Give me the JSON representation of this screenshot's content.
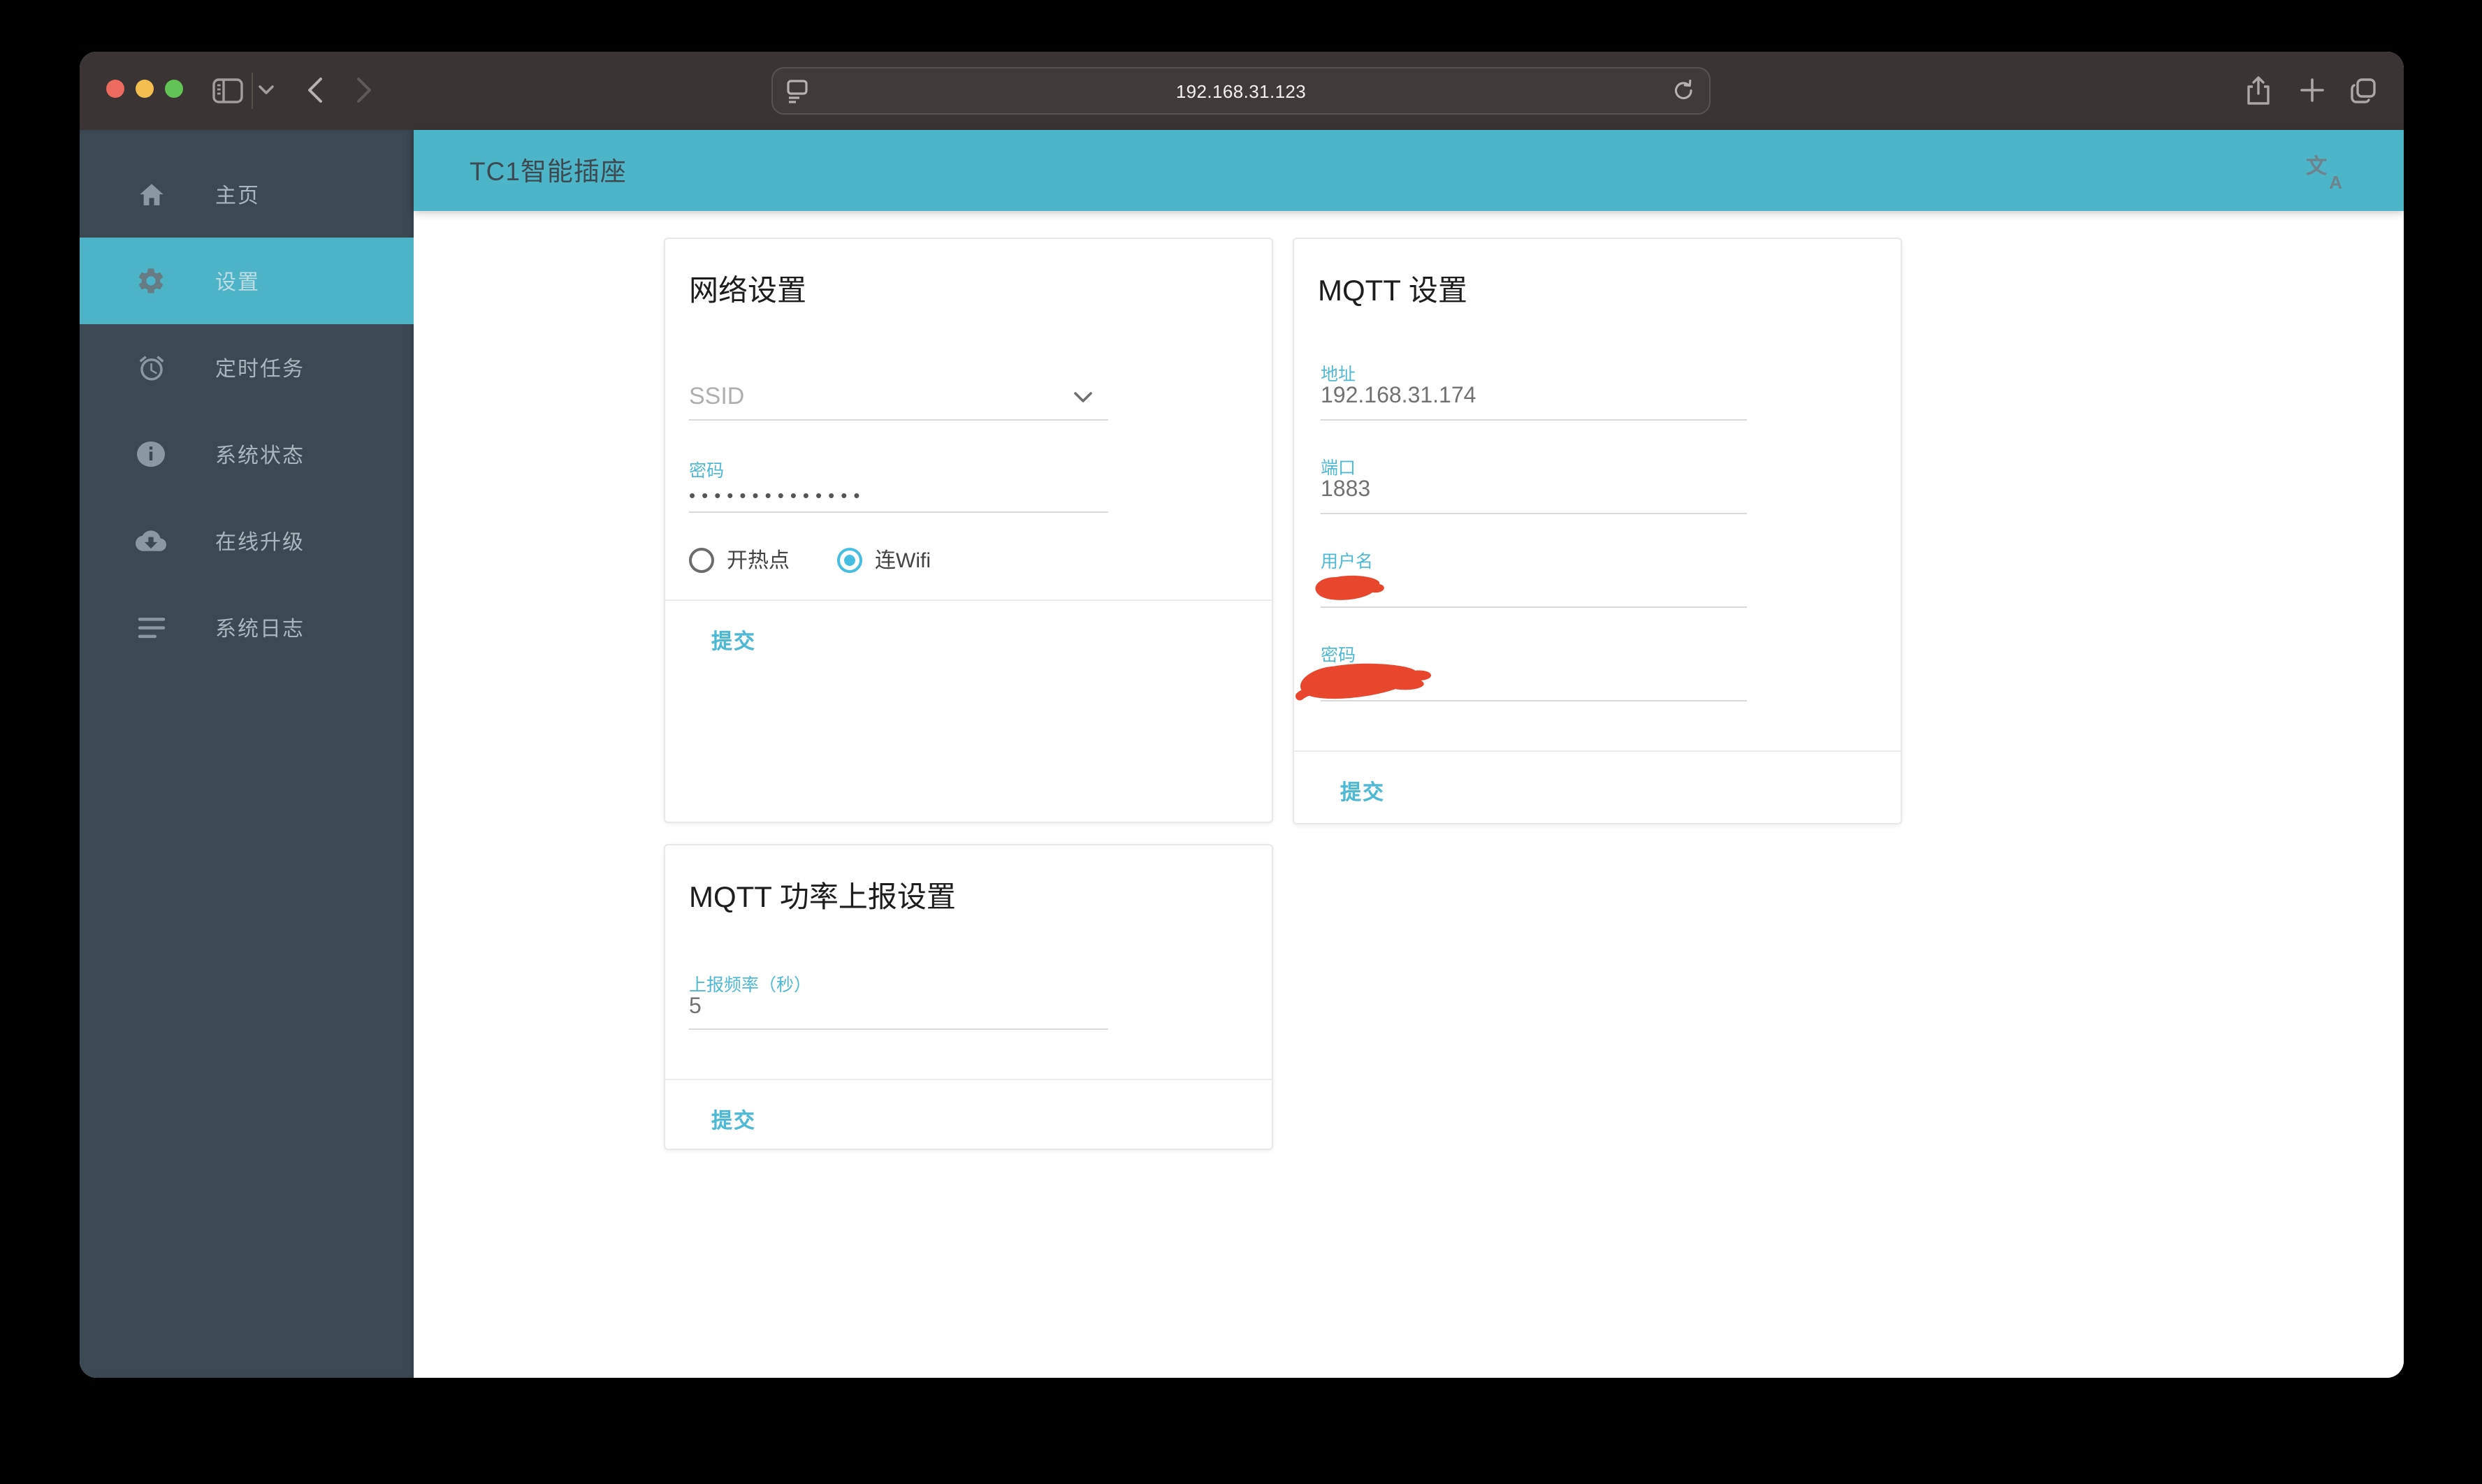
{
  "browser": {
    "url": "192.168.31.123",
    "traffic_lights": [
      "close",
      "minimize",
      "zoom"
    ],
    "left_icons": [
      "sidebar-toggle-icon",
      "chevron-down-icon",
      "back-icon",
      "forward-icon"
    ],
    "url_icons": [
      "reader-icon",
      "refresh-icon"
    ],
    "right_icons": [
      "share-icon",
      "new-tab-icon",
      "tab-overview-icon"
    ]
  },
  "header": {
    "title": "TC1智能插座",
    "translate_icon": {
      "zh": "文",
      "en": "A"
    }
  },
  "sidebar": {
    "items": [
      {
        "label": "主页",
        "icon": "home-icon",
        "active": false
      },
      {
        "label": "设置",
        "icon": "gear-icon",
        "active": true
      },
      {
        "label": "定时任务",
        "icon": "alarm-icon",
        "active": false
      },
      {
        "label": "系统状态",
        "icon": "info-icon",
        "active": false
      },
      {
        "label": "在线升级",
        "icon": "cloud-download-icon",
        "active": false
      },
      {
        "label": "系统日志",
        "icon": "log-lines-icon",
        "active": false
      }
    ]
  },
  "network_card": {
    "title": "网络设置",
    "ssid_placeholder": "SSID",
    "password_label": "密码",
    "password_masked": "••••••••••••••",
    "radio_hotspot": "开热点",
    "radio_wifi": "连Wifi",
    "radio_selected": "连Wifi",
    "submit_label": "提交"
  },
  "mqtt_card": {
    "title": "MQTT 设置",
    "address_label": "地址",
    "address_value": "192.168.31.174",
    "port_label": "端口",
    "port_value": "1883",
    "username_label": "用户名",
    "username_value_redacted": true,
    "password_label": "密码",
    "password_value_redacted": true,
    "submit_label": "提交"
  },
  "power_card": {
    "title": "MQTT 功率上报设置",
    "freq_label": "上报频率（秒）",
    "freq_value": "5",
    "submit_label": "提交"
  },
  "colors": {
    "accent_teal": "#4DB5C8",
    "label_blue": "#4FB9D4",
    "sidebar_bg": "#3C4952",
    "chrome_bg": "#3A3534",
    "redaction_red": "#E9472D"
  }
}
